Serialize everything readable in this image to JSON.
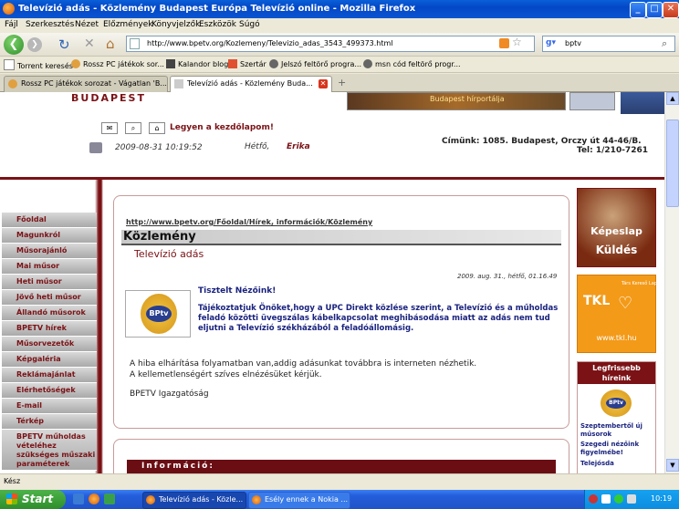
{
  "window": {
    "title": "Televízió adás - Közlemény Budapest Európa Televízió online - Mozilla Firefox"
  },
  "menu": [
    "Fájl",
    "Szerkesztés",
    "Nézet",
    "Előzmények",
    "Könyvjelzők",
    "Eszközök",
    "Súgó"
  ],
  "url": "http://www.bpetv.org/Kozlemeny/Televizio_adas_3543_499373.html",
  "search": {
    "value": "bptv"
  },
  "bookmarks": [
    "Torrent keresés",
    "Rossz PC játékok sor...",
    "Kalandor blog",
    "Szertár",
    "Jelszó feltörő progra...",
    "msn cód feltörő progr..."
  ],
  "tabs": [
    {
      "label": "Rossz PC játékok sorozat - Vágatlan 'B..."
    },
    {
      "label": "Televízió adás - Közlemény Buda..."
    }
  ],
  "site": {
    "city": "BUDAPEST",
    "banner": "Budapest hírportálja",
    "homepage_link": "Legyen a kezdőlapom!",
    "datetime": "2009-08-31 10:19:52",
    "day": "Hétfő,",
    "nameday": "Erika",
    "address": "Címünk: 1085. Budapest, Orczy út 44-46/B.",
    "phone": "Tel: 1/210-7261"
  },
  "nav": [
    "Főoldal",
    "Magunkról",
    "Műsorajánló",
    "Mai műsor",
    "Heti műsor",
    "Jövő heti műsor",
    "Állandó műsorok",
    "BPETV hírek",
    "Műsorvezetők",
    "Képgaléria",
    "Reklámajánlat",
    "Elérhetőségek",
    "E-mail",
    "Térkép",
    "BPETV műholdas vételéhez szükséges műszaki paraméterek"
  ],
  "article": {
    "breadcrumb": "http://www.bpetv.org/Főoldal/Hírek, információk/Közlemény",
    "heading": "Közlemény",
    "subheading": "Televízió adás",
    "date": "2009. aug. 31., hétfő, 01.16.49",
    "greeting": "Tisztelt Nézőink!",
    "lead": "Tájékoztatjuk Önöket,hogy a UPC Direkt közlése szerint, a Televízió és a műholdas feladó közötti üvegszálas kábelkapcsolat meghibásodása miatt  az adás nem tud eljutni a Televízió székházából a feladóállomásig.",
    "body1": "A hiba elhárítása folyamatban van,addig adásunkat továbbra is interneten nézhetik.",
    "body2": "A kellemetlenségért szíves elnézésüket kérjük.",
    "signature": "BPETV Igazgatóság",
    "logo": "BUDAPEST BPtv EURÓPA"
  },
  "info_heading": "Információ:",
  "right": {
    "kepeslap1": "Képeslap",
    "kepeslap2": "Küldés",
    "tkl_brand": "TKL",
    "tkl_sub": "Társ Kereső Lap",
    "tkl_url": "www.tkl.hu",
    "news_title": "Legfrissebb híreink",
    "news": [
      "Szeptembertől új műsorok",
      "Szegedi nézőink figyelmébe!",
      "Telejósda"
    ]
  },
  "status": "Kész",
  "taskbar": {
    "start": "Start",
    "items": [
      "Televízió adás - Közle...",
      "Esély ennek a Nokia ..."
    ],
    "clock": "10:19"
  },
  "colors": {
    "accent": "#7a1216",
    "xp_blue": "#245edb"
  }
}
